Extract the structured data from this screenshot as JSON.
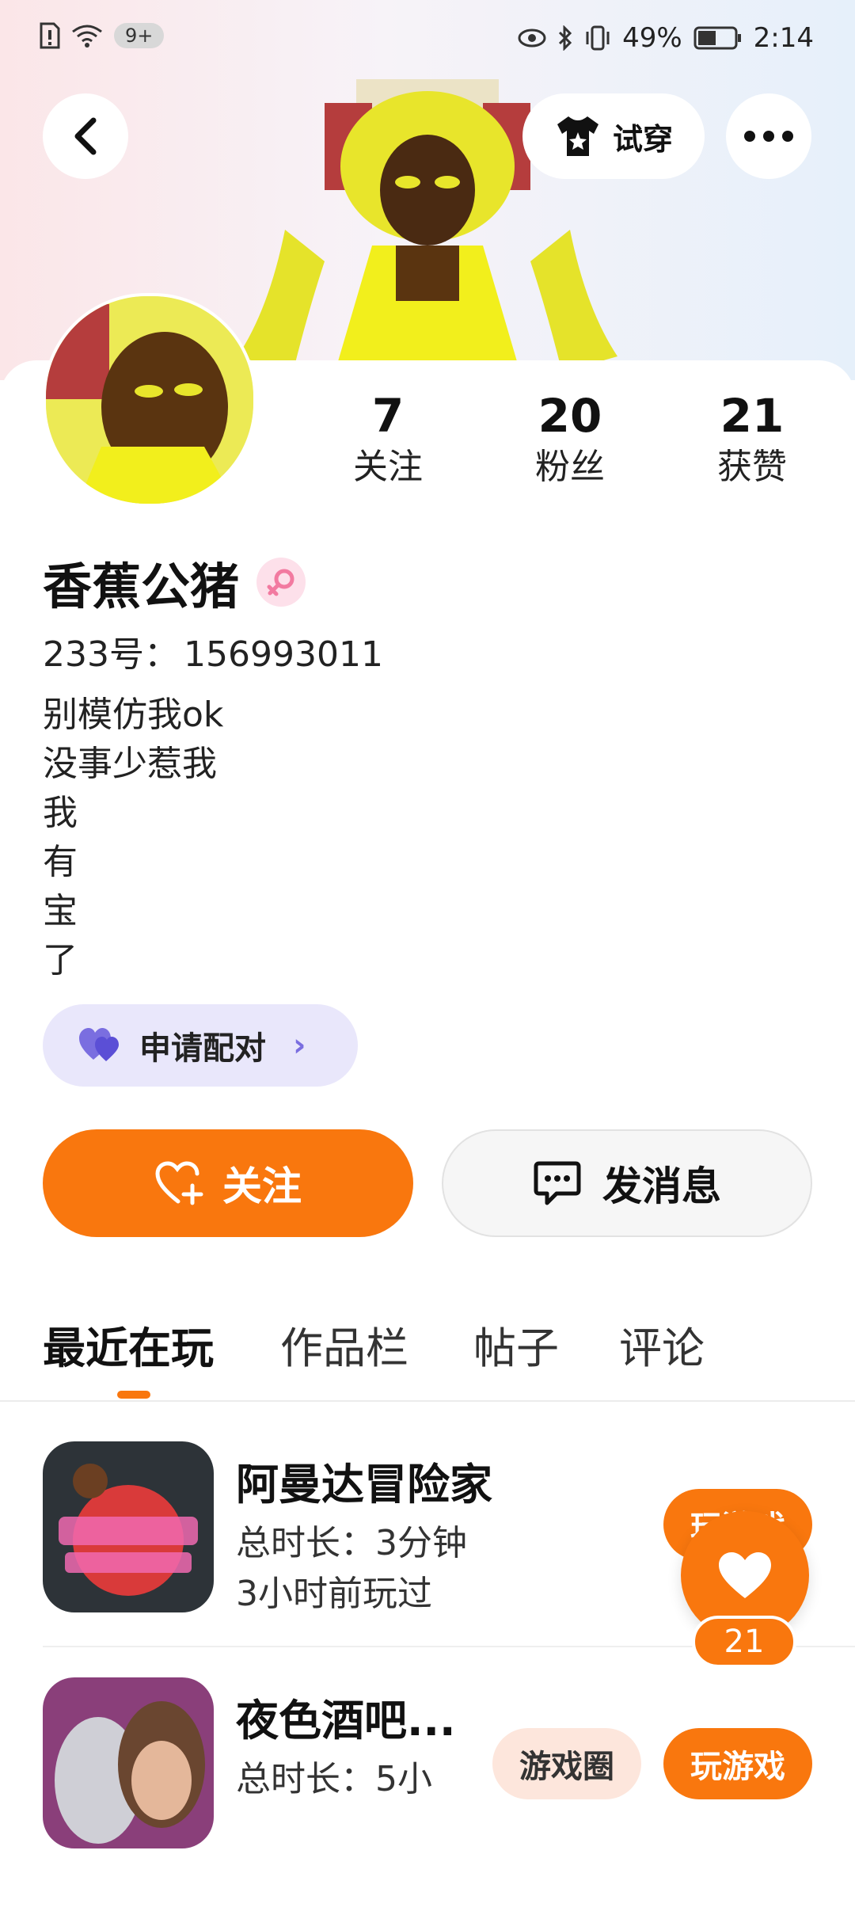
{
  "statusbar": {
    "notification_badge": "9+",
    "battery_text": "49%",
    "time": "2:14"
  },
  "header": {
    "try_on_label": "试穿"
  },
  "profile": {
    "stats": [
      {
        "num": "7",
        "label": "关注"
      },
      {
        "num": "20",
        "label": "粉丝"
      },
      {
        "num": "21",
        "label": "获赞"
      }
    ],
    "name": "香蕉公猪",
    "id_label": "233号：",
    "id_value": "156993011",
    "bio": [
      "别模仿我ok",
      "没事少惹我",
      "我",
      "有",
      "宝",
      "了"
    ],
    "pair_label": "申请配对",
    "follow_label": "关注",
    "message_label": "发消息"
  },
  "tabs": [
    "最近在玩",
    "作品栏",
    "帖子",
    "评论"
  ],
  "games": [
    {
      "title": "阿曼达冒险家",
      "duration": "总时长：3分钟",
      "last_played": "3小时前玩过",
      "play_label": "玩游戏"
    },
    {
      "title": "夜色酒吧...",
      "duration": "总时长：5小",
      "circle_label": "游戏圈",
      "play_label": "玩游戏"
    }
  ],
  "float_like": {
    "count": "21"
  },
  "colors": {
    "accent": "#f9770e",
    "pair_bg": "#e9e7fb",
    "gender_bg": "#fde0ea"
  }
}
